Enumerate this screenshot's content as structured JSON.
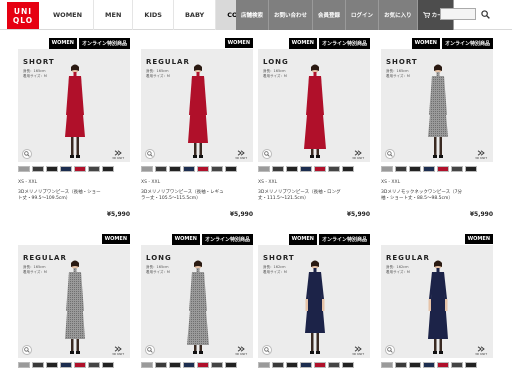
{
  "header": {
    "logo_line1": "UNI",
    "logo_line2": "QLO",
    "nav": [
      "WOMEN",
      "MEN",
      "KIDS",
      "BABY",
      "COMPANY"
    ],
    "util": [
      "店舗検索",
      "お問い合わせ",
      "会員登録",
      "ログイン",
      "お気に入り",
      "カート"
    ]
  },
  "colors": {
    "brand": "#e60012",
    "tag_bg": "#000000",
    "util_bg": "#7f7f7f"
  },
  "products": [
    {
      "fit": "SHORT",
      "spec1": "身長：165cm",
      "spec2": "着用サイズ：M",
      "tags": [
        "WOMEN",
        "オンライン特別商品"
      ],
      "sizes": "XS - XXL",
      "name1": "3Dメリノリブワンピース（長袖・ショー",
      "name2": "ト丈・99.5〜109.5cm）",
      "price": "¥5,990",
      "dress": "#b0102a",
      "swatches": [
        "#9a9a9a",
        "#3a3a3a",
        "#222222",
        "#1c2d4f",
        "#b0102a",
        "#444444",
        "#222222"
      ]
    },
    {
      "fit": "REGULAR",
      "spec1": "身長：165cm",
      "spec2": "着用サイズ：M",
      "tags": [
        "WOMEN"
      ],
      "sizes": "XS - XXL",
      "name1": "3Dメリノリブワンピース（長袖・レギュ",
      "name2": "ラー丈・105.5〜115.5cm）",
      "price": "¥5,990",
      "dress": "#b0102a",
      "swatches": [
        "#9a9a9a",
        "#3a3a3a",
        "#222222",
        "#1c2d4f",
        "#b0102a",
        "#444444",
        "#222222"
      ]
    },
    {
      "fit": "LONG",
      "spec1": "身長：165cm",
      "spec2": "着用サイズ：M",
      "tags": [
        "WOMEN",
        "オンライン特別商品"
      ],
      "sizes": "XS - XXL",
      "name1": "3Dメリノリブワンピース（長袖・ロング",
      "name2": "丈・111.5〜121.5cm）",
      "price": "¥5,990",
      "dress": "#b0102a",
      "swatches": [
        "#9a9a9a",
        "#3a3a3a",
        "#222222",
        "#1c2d4f",
        "#b0102a",
        "#444444",
        "#222222"
      ]
    },
    {
      "fit": "SHORT",
      "spec1": "身長：165cm",
      "spec2": "着用サイズ：M",
      "tags": [
        "WOMEN",
        "オンライン特別商品"
      ],
      "sizes": "XS - XXL",
      "name1": "3Dメリノモックネックワンピース（7分",
      "name2": "袖・ショート丈・88.5〜98.5cm）",
      "price": "¥5,990",
      "dress": "#8c8c8c",
      "swatches": [
        "#9a9a9a",
        "#3a3a3a",
        "#222222",
        "#1c2d4f",
        "#b0102a",
        "#444444",
        "#222222"
      ]
    },
    {
      "fit": "REGULAR",
      "spec1": "身長：165cm",
      "spec2": "着用サイズ：M",
      "tags": [
        "WOMEN"
      ],
      "dress": "#8c8c8c",
      "swatches": [
        "#9a9a9a",
        "#3a3a3a",
        "#222222",
        "#1c2d4f",
        "#b0102a",
        "#444444",
        "#222222"
      ]
    },
    {
      "fit": "LONG",
      "spec1": "身長：165cm",
      "spec2": "着用サイズ：M",
      "tags": [
        "WOMEN",
        "オンライン特別商品"
      ],
      "dress": "#8c8c8c",
      "swatches": [
        "#9a9a9a",
        "#3a3a3a",
        "#222222",
        "#1c2d4f",
        "#b0102a",
        "#444444",
        "#222222"
      ]
    },
    {
      "fit": "SHORT",
      "spec1": "身長：162cm",
      "spec2": "着用サイズ：M",
      "tags": [
        "WOMEN",
        "オンライン特別商品"
      ],
      "dress": "#1c2348",
      "swatches": [
        "#9a9a9a",
        "#3a3a3a",
        "#222222",
        "#1c2d4f",
        "#b0102a",
        "#444444",
        "#222222"
      ]
    },
    {
      "fit": "REGULAR",
      "spec1": "身長：162cm",
      "spec2": "着用サイズ：M",
      "tags": [
        "WOMEN"
      ],
      "dress": "#1c2348",
      "swatches": [
        "#9a9a9a",
        "#3a3a3a",
        "#222222",
        "#1c2d4f",
        "#b0102a",
        "#444444",
        "#222222"
      ]
    }
  ],
  "icons": {
    "search": "search-icon",
    "zoom": "magnify-icon",
    "knit": "3d-knit-icon"
  },
  "knit_label": "3D KNIT"
}
